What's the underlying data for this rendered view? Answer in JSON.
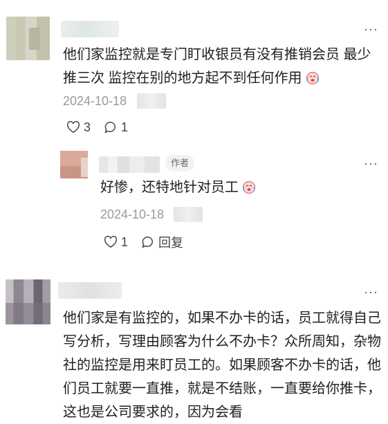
{
  "comments": [
    {
      "text": "他们家监控就是专门盯收银员有没有推销会员 最少推三次 监控在别的地方起不到任何作用",
      "date": "2024-10-18",
      "likes": "3",
      "replies": "1",
      "emoji": "crying-face-emoji"
    },
    {
      "author_tag": "作者",
      "text": "好惨，还特地针对员工",
      "date": "2024-10-18",
      "likes": "1",
      "reply_label": "回复",
      "emoji": "crying-face-emoji"
    },
    {
      "text": "他们家是有监控的，如果不办卡的话，员工就得自己写分析，写理由顾客为什么不办卡？众所周知，杂物社的监控是用来盯员工的。如果顾客不办卡的话，他们员工就要一直推，就是不结账，一直要给你推卡，这也是公司要求的，因为会看"
    }
  ],
  "more_icon": "more-horizontal-icon"
}
